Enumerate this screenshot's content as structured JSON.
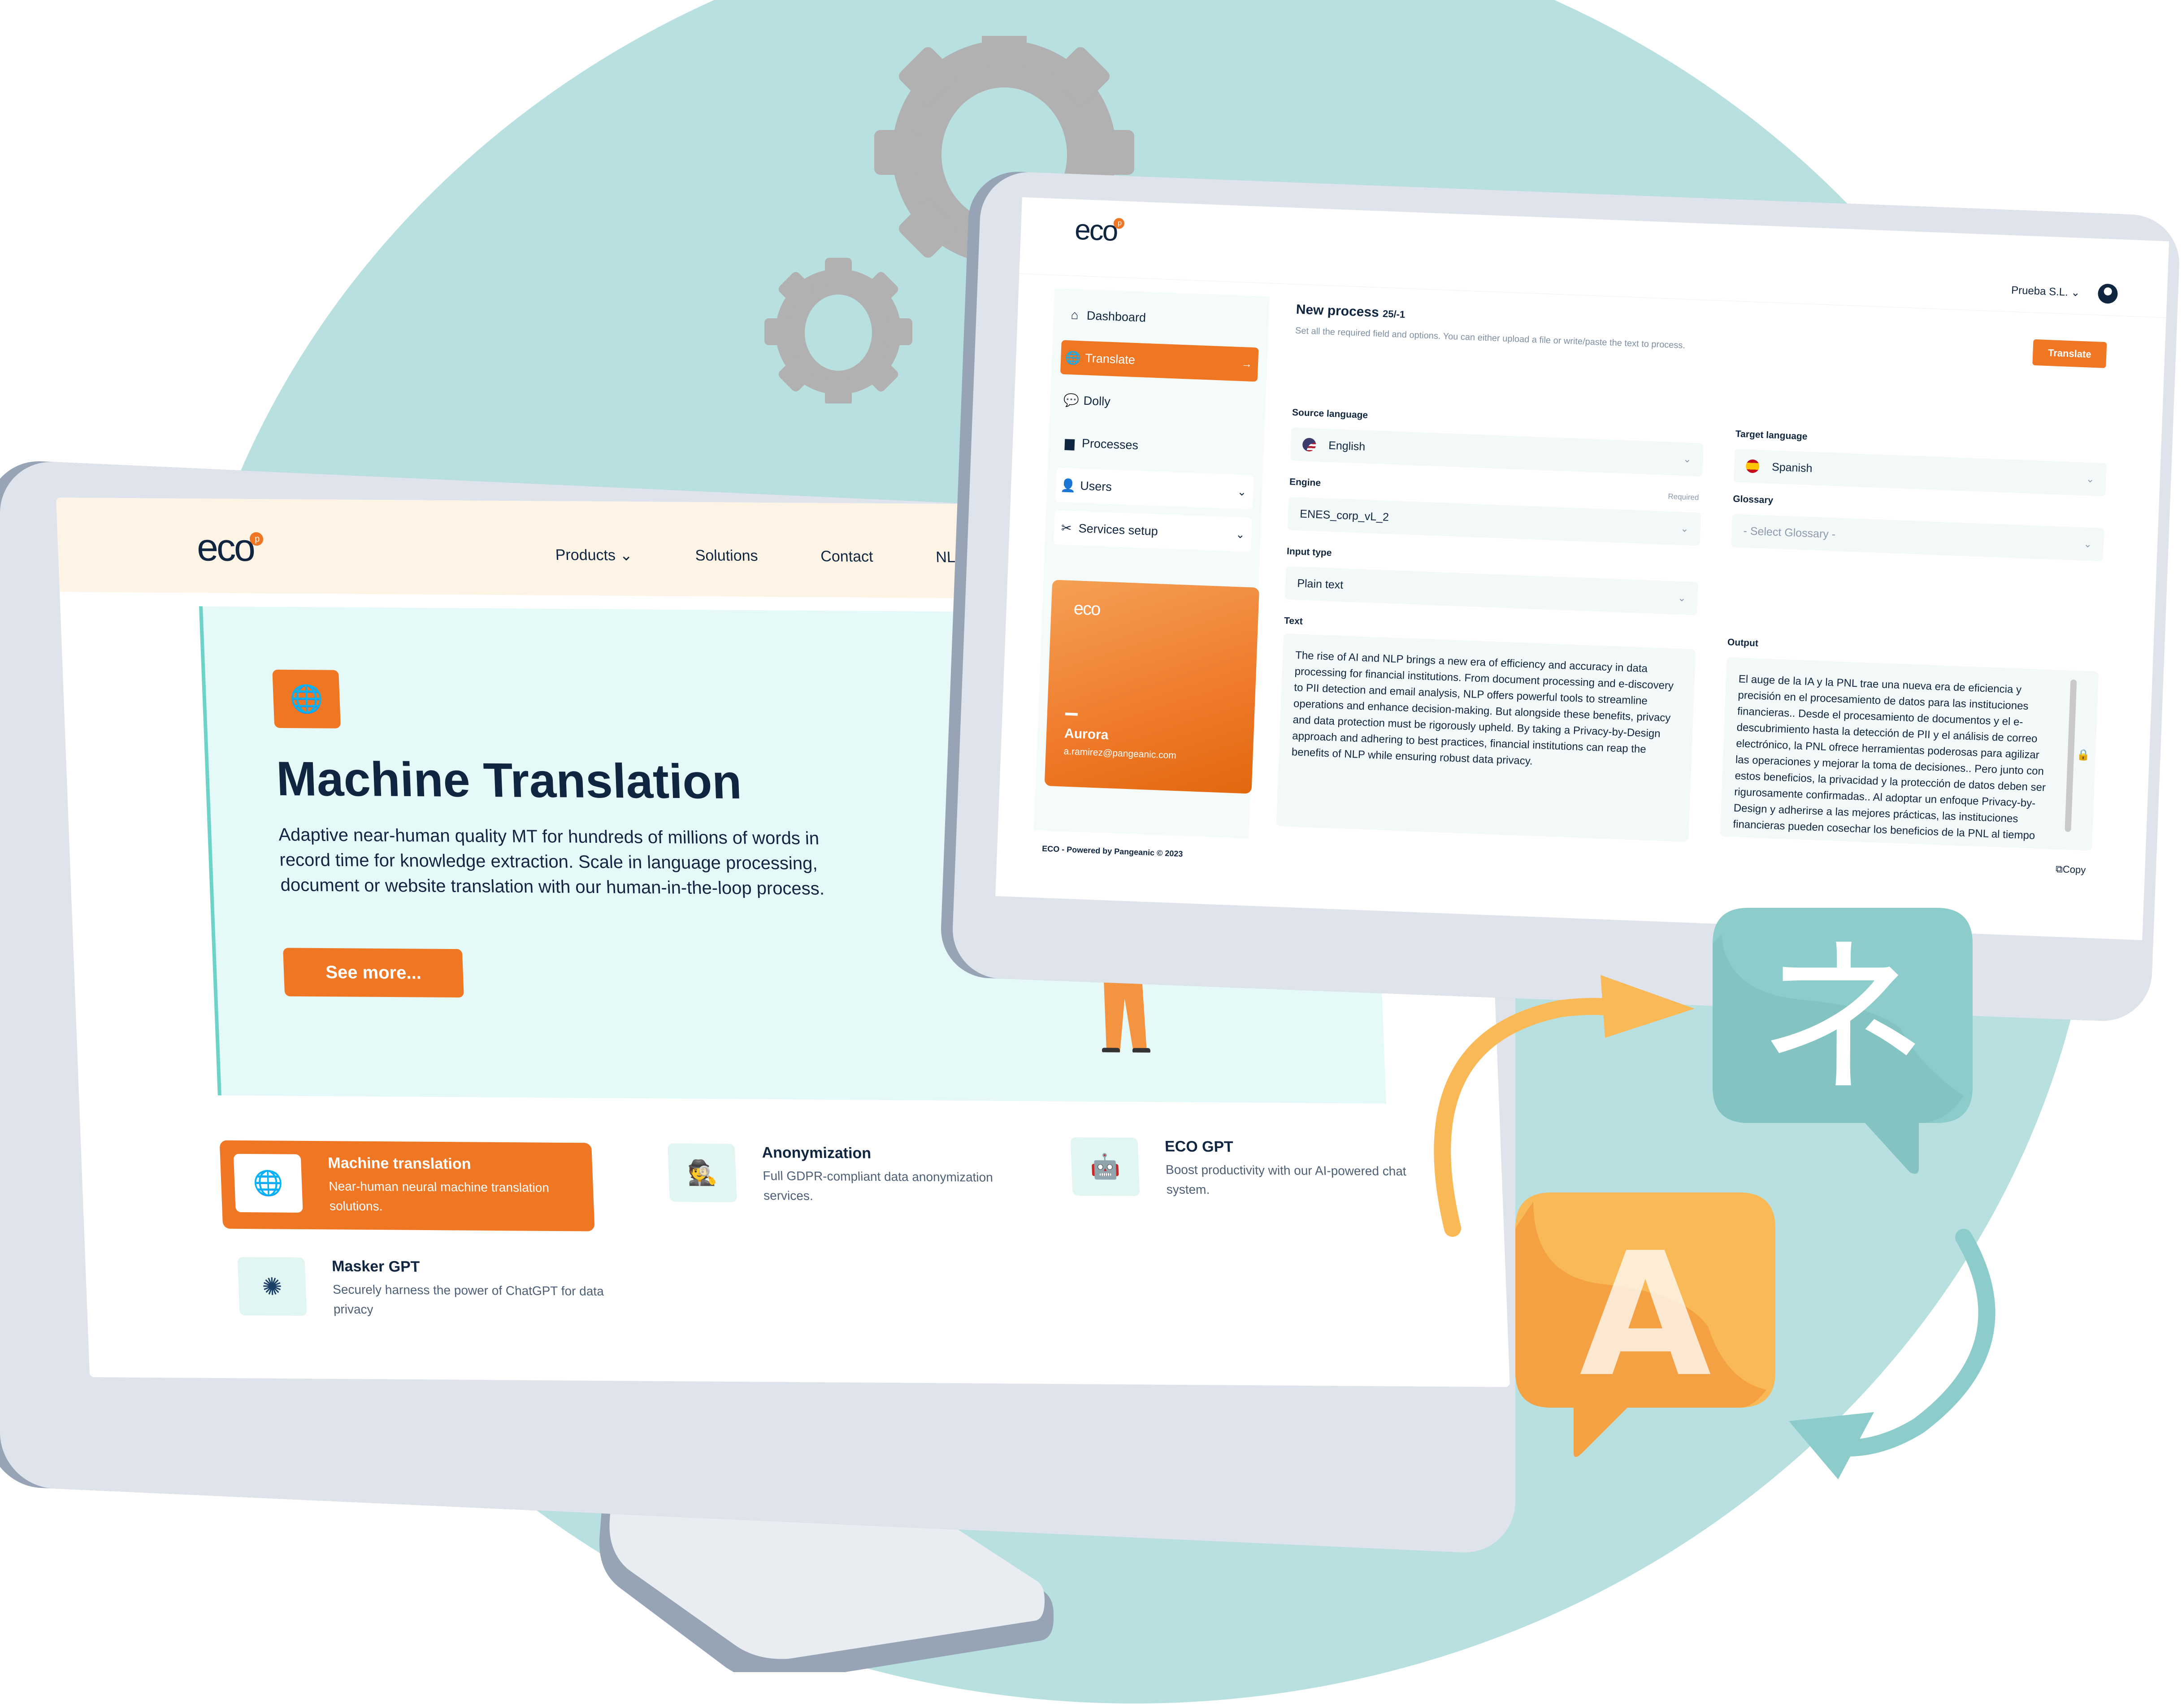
{
  "colors": {
    "brand_orange": "#ef7622",
    "navy": "#0f2540",
    "teal_bg": "#b8e0e0",
    "hero_bg": "#e6f9f9",
    "nav_bg": "#fef4e6"
  },
  "website": {
    "logo": "eco",
    "logo_badge": "p",
    "nav": [
      {
        "label": "Products",
        "has_dropdown": true
      },
      {
        "label": "Solutions"
      },
      {
        "label": "Contact"
      },
      {
        "label": "NLP Pa"
      }
    ],
    "hero": {
      "icon": "globe-icon",
      "title": "Machine Translation",
      "description": "Adaptive near-human quality MT for hundreds of millions of words in record time for knowledge extraction. Scale in language processing, document or website translation with our human-in-the-loop process.",
      "cta": "See more..."
    },
    "products": [
      {
        "icon": "globe-icon",
        "title": "Machine translation",
        "description": "Near-human neural machine translation solutions.",
        "active": true
      },
      {
        "icon": "spy-icon",
        "title": "Anonymization",
        "description": "Full GDPR-compliant data anonymization services."
      },
      {
        "icon": "robot-icon",
        "title": "ECO GPT",
        "description": "Boost productivity with our AI-powered chat system."
      },
      {
        "icon": "openai-icon",
        "title": "Masker GPT",
        "description": "Securely harness the power of ChatGPT for data privacy"
      }
    ]
  },
  "app": {
    "logo": "eco",
    "logo_badge": "p",
    "account": "Prueba S.L.",
    "sidebar": [
      {
        "icon": "home-icon",
        "label": "Dashboard"
      },
      {
        "icon": "globe-icon",
        "label": "Translate",
        "active": true,
        "arrow": "→"
      },
      {
        "icon": "chat-icon",
        "label": "Dolly"
      },
      {
        "icon": "briefcase-icon",
        "label": "Processes"
      },
      {
        "icon": "user-icon",
        "label": "Users",
        "expandable": true
      },
      {
        "icon": "tools-icon",
        "label": "Services setup",
        "expandable": true
      }
    ],
    "profile": {
      "logo": "eco",
      "name": "Aurora",
      "email": "a.ramirez@pangeanic.com"
    },
    "footer": "ECO - Powered by Pangeanic © 2023",
    "page": {
      "title": "New process",
      "title_suffix": "25/-1",
      "subtitle": "Set all the required field and options. You can either upload a file or write/paste the text to process.",
      "translate_button": "Translate"
    },
    "form": {
      "source_language": {
        "label": "Source language",
        "value": "English",
        "flag": "us"
      },
      "target_language": {
        "label": "Target language",
        "value": "Spanish",
        "flag": "es"
      },
      "engine": {
        "label": "Engine",
        "required_label": "Required",
        "value": "ENES_corp_vL_2"
      },
      "glossary": {
        "label": "Glossary",
        "placeholder": "- Select Glossary -"
      },
      "input_type": {
        "label": "Input type",
        "value": "Plain text"
      },
      "text": {
        "label": "Text",
        "value": "The rise of AI and NLP brings a new era of efficiency and accuracy in data processing for financial institutions. From document processing and e-discovery to PII detection and email analysis, NLP offers powerful tools to streamline operations and enhance decision-making. But alongside these benefits, privacy and data protection must be rigorously upheld. By taking a Privacy-by-Design approach and adhering to best practices, financial institutions can reap the benefits of NLP while ensuring robust data privacy."
      },
      "output": {
        "label": "Output",
        "value": "El auge de la IA y la PNL trae una nueva era de eficiencia y precisión en el procesamiento de datos para las instituciones financieras.. Desde el procesamiento de documentos y el e-descubrimiento hasta la detección de PII y el análisis de correo electrónico, la PNL ofrece herramientas poderosas para agilizar las operaciones y mejorar la toma de decisiones.. Pero junto con estos beneficios, la privacidad y la protección de datos deben ser rigurosamente confirmadas.. Al adoptar un enfoque Privacy-by-Design y adherirse a las mejores prácticas, las instituciones financieras pueden cosechar los beneficios de la PNL al tiempo",
        "copy_label": "Copy"
      }
    }
  },
  "decor": {
    "bubble_japanese_glyph": "ネ",
    "bubble_latin_glyph": "A"
  }
}
